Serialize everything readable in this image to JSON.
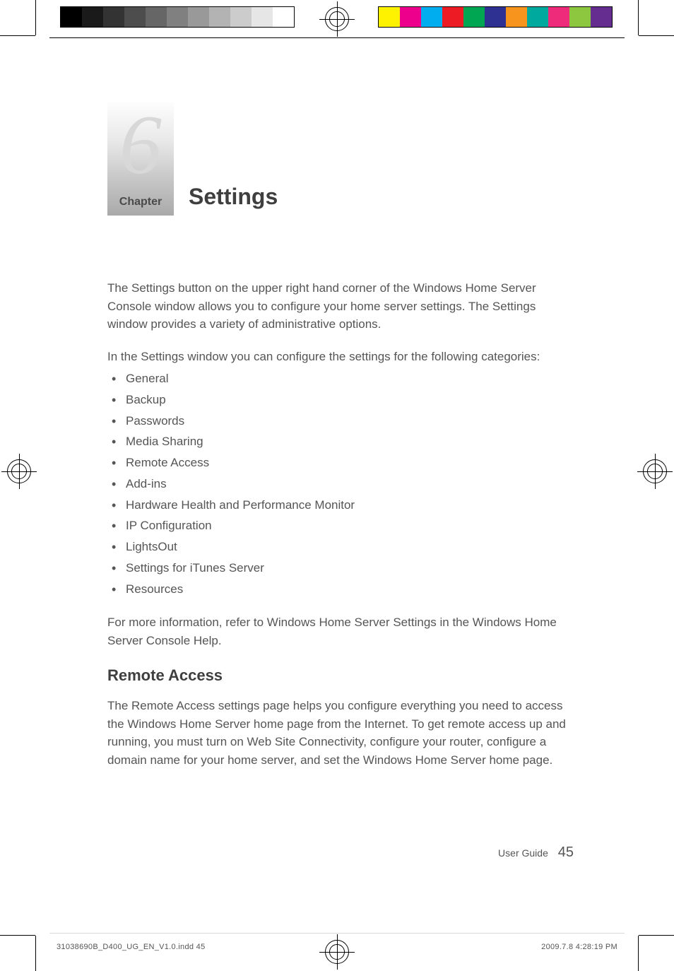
{
  "printer_marks": {
    "gray_steps": [
      "#000000",
      "#1a1a1a",
      "#333333",
      "#4d4d4d",
      "#666666",
      "#808080",
      "#999999",
      "#b3b3b3",
      "#cccccc",
      "#e6e6e6",
      "#ffffff"
    ],
    "color_steps": [
      "#fff200",
      "#ec008c",
      "#00aeef",
      "#ed1c24",
      "#00a651",
      "#2e3192",
      "#f7941d",
      "#00a99d",
      "#ee2a7b",
      "#8dc63f",
      "#662d91"
    ]
  },
  "chapter": {
    "number": "6",
    "label": "Chapter",
    "title": "Settings"
  },
  "intro_para": "The Settings button on the upper right hand corner of the Windows Home Server Console window allows you to configure your home server settings. The Settings window provides a variety of administrative options.",
  "lead_in": "In the Settings window you can configure the settings for the following categories:",
  "categories": [
    "General",
    "Backup",
    "Passwords",
    "Media Sharing",
    "Remote Access",
    "Add-ins",
    "Hardware Health and Performance Monitor",
    "IP Configuration",
    "LightsOut",
    "Settings for iTunes Server",
    "Resources"
  ],
  "more_info": "For more information, refer to Windows Home Server Settings in the Windows Home Server Console Help.",
  "section": {
    "heading": "Remote Access",
    "para": "The Remote Access settings page helps you configure everything you need to access the Windows Home Server home page from the Internet. To get remote access up and running, you must turn on Web Site Connectivity, configure your router, configure a domain name for your home server, and set the Windows Home Server home page."
  },
  "footer": {
    "doc_label": "User Guide",
    "page_number": "45"
  },
  "slug": {
    "file": "31038690B_D400_UG_EN_V1.0.indd   45",
    "date": "2009.7.8   4:28:19 PM"
  }
}
